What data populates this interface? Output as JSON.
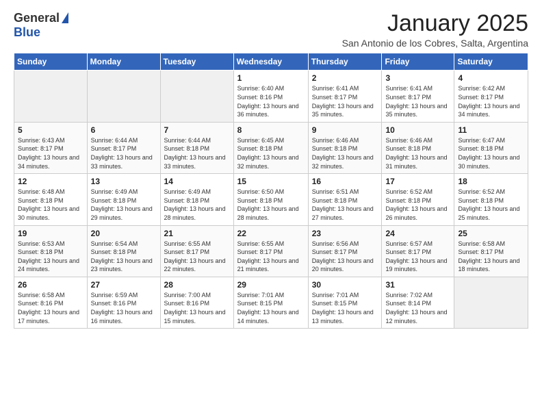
{
  "header": {
    "logo_general": "General",
    "logo_blue": "Blue",
    "month_title": "January 2025",
    "location": "San Antonio de los Cobres, Salta, Argentina"
  },
  "days_of_week": [
    "Sunday",
    "Monday",
    "Tuesday",
    "Wednesday",
    "Thursday",
    "Friday",
    "Saturday"
  ],
  "weeks": [
    [
      {
        "day": "",
        "info": ""
      },
      {
        "day": "",
        "info": ""
      },
      {
        "day": "",
        "info": ""
      },
      {
        "day": "1",
        "info": "Sunrise: 6:40 AM\nSunset: 8:16 PM\nDaylight: 13 hours and 36 minutes."
      },
      {
        "day": "2",
        "info": "Sunrise: 6:41 AM\nSunset: 8:17 PM\nDaylight: 13 hours and 35 minutes."
      },
      {
        "day": "3",
        "info": "Sunrise: 6:41 AM\nSunset: 8:17 PM\nDaylight: 13 hours and 35 minutes."
      },
      {
        "day": "4",
        "info": "Sunrise: 6:42 AM\nSunset: 8:17 PM\nDaylight: 13 hours and 34 minutes."
      }
    ],
    [
      {
        "day": "5",
        "info": "Sunrise: 6:43 AM\nSunset: 8:17 PM\nDaylight: 13 hours and 34 minutes."
      },
      {
        "day": "6",
        "info": "Sunrise: 6:44 AM\nSunset: 8:17 PM\nDaylight: 13 hours and 33 minutes."
      },
      {
        "day": "7",
        "info": "Sunrise: 6:44 AM\nSunset: 8:18 PM\nDaylight: 13 hours and 33 minutes."
      },
      {
        "day": "8",
        "info": "Sunrise: 6:45 AM\nSunset: 8:18 PM\nDaylight: 13 hours and 32 minutes."
      },
      {
        "day": "9",
        "info": "Sunrise: 6:46 AM\nSunset: 8:18 PM\nDaylight: 13 hours and 32 minutes."
      },
      {
        "day": "10",
        "info": "Sunrise: 6:46 AM\nSunset: 8:18 PM\nDaylight: 13 hours and 31 minutes."
      },
      {
        "day": "11",
        "info": "Sunrise: 6:47 AM\nSunset: 8:18 PM\nDaylight: 13 hours and 30 minutes."
      }
    ],
    [
      {
        "day": "12",
        "info": "Sunrise: 6:48 AM\nSunset: 8:18 PM\nDaylight: 13 hours and 30 minutes."
      },
      {
        "day": "13",
        "info": "Sunrise: 6:49 AM\nSunset: 8:18 PM\nDaylight: 13 hours and 29 minutes."
      },
      {
        "day": "14",
        "info": "Sunrise: 6:49 AM\nSunset: 8:18 PM\nDaylight: 13 hours and 28 minutes."
      },
      {
        "day": "15",
        "info": "Sunrise: 6:50 AM\nSunset: 8:18 PM\nDaylight: 13 hours and 28 minutes."
      },
      {
        "day": "16",
        "info": "Sunrise: 6:51 AM\nSunset: 8:18 PM\nDaylight: 13 hours and 27 minutes."
      },
      {
        "day": "17",
        "info": "Sunrise: 6:52 AM\nSunset: 8:18 PM\nDaylight: 13 hours and 26 minutes."
      },
      {
        "day": "18",
        "info": "Sunrise: 6:52 AM\nSunset: 8:18 PM\nDaylight: 13 hours and 25 minutes."
      }
    ],
    [
      {
        "day": "19",
        "info": "Sunrise: 6:53 AM\nSunset: 8:18 PM\nDaylight: 13 hours and 24 minutes."
      },
      {
        "day": "20",
        "info": "Sunrise: 6:54 AM\nSunset: 8:18 PM\nDaylight: 13 hours and 23 minutes."
      },
      {
        "day": "21",
        "info": "Sunrise: 6:55 AM\nSunset: 8:17 PM\nDaylight: 13 hours and 22 minutes."
      },
      {
        "day": "22",
        "info": "Sunrise: 6:55 AM\nSunset: 8:17 PM\nDaylight: 13 hours and 21 minutes."
      },
      {
        "day": "23",
        "info": "Sunrise: 6:56 AM\nSunset: 8:17 PM\nDaylight: 13 hours and 20 minutes."
      },
      {
        "day": "24",
        "info": "Sunrise: 6:57 AM\nSunset: 8:17 PM\nDaylight: 13 hours and 19 minutes."
      },
      {
        "day": "25",
        "info": "Sunrise: 6:58 AM\nSunset: 8:17 PM\nDaylight: 13 hours and 18 minutes."
      }
    ],
    [
      {
        "day": "26",
        "info": "Sunrise: 6:58 AM\nSunset: 8:16 PM\nDaylight: 13 hours and 17 minutes."
      },
      {
        "day": "27",
        "info": "Sunrise: 6:59 AM\nSunset: 8:16 PM\nDaylight: 13 hours and 16 minutes."
      },
      {
        "day": "28",
        "info": "Sunrise: 7:00 AM\nSunset: 8:16 PM\nDaylight: 13 hours and 15 minutes."
      },
      {
        "day": "29",
        "info": "Sunrise: 7:01 AM\nSunset: 8:15 PM\nDaylight: 13 hours and 14 minutes."
      },
      {
        "day": "30",
        "info": "Sunrise: 7:01 AM\nSunset: 8:15 PM\nDaylight: 13 hours and 13 minutes."
      },
      {
        "day": "31",
        "info": "Sunrise: 7:02 AM\nSunset: 8:14 PM\nDaylight: 13 hours and 12 minutes."
      },
      {
        "day": "",
        "info": ""
      }
    ]
  ]
}
